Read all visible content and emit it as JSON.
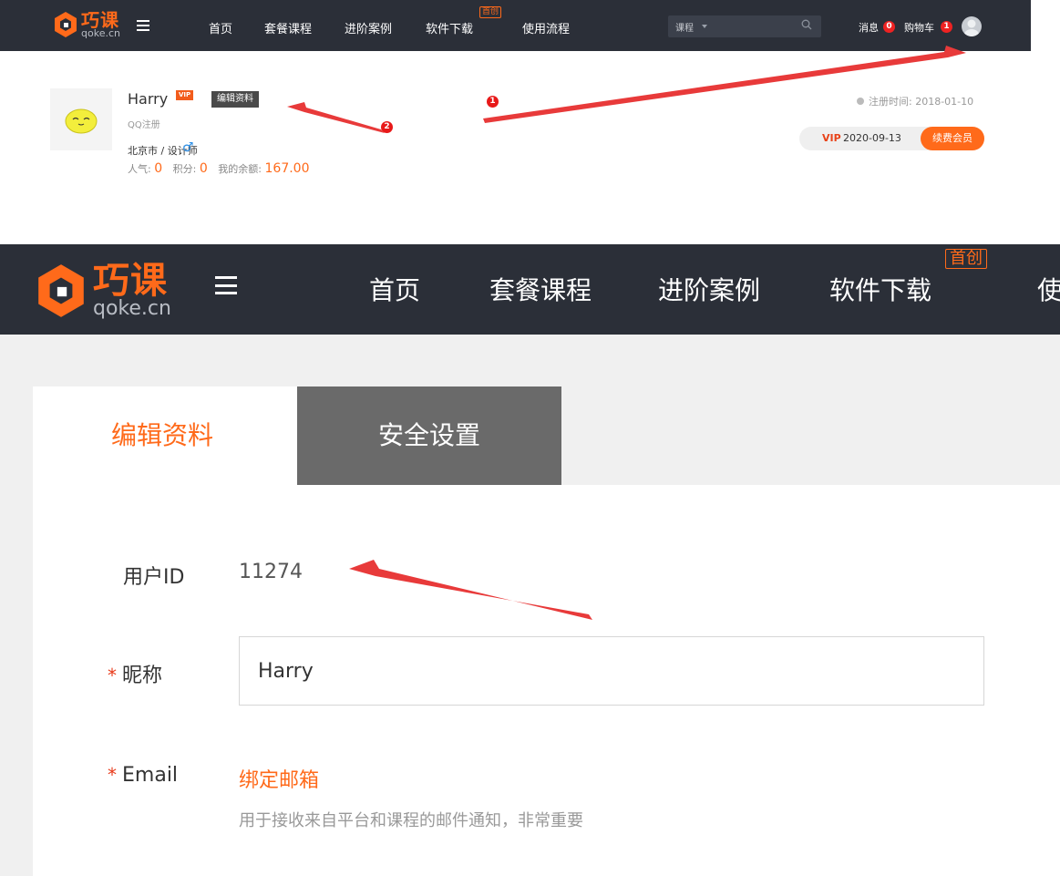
{
  "brand": {
    "name_cn": "巧课",
    "domain": "qoke.cn",
    "accent": "#ff6a1a"
  },
  "nav": {
    "items": [
      "首页",
      "套餐课程",
      "进阶案例",
      "软件下载",
      "使用流程"
    ],
    "new_badge": "首创",
    "search_category": "课程",
    "messages_label": "消息",
    "messages_count": "0",
    "cart_label": "购物车",
    "cart_count": "1"
  },
  "nav_large": {
    "last_item_partial": "使"
  },
  "profile": {
    "name": "Harry",
    "vip_tag": "VIP",
    "edit_button": "编辑资料",
    "reg_source": "QQ注册",
    "location": "北京市 / 设计师",
    "gender_icon": "♂",
    "popularity_label": "人气:",
    "popularity": "0",
    "points_label": "积分:",
    "points": "0",
    "balance_label": "我的余额:",
    "balance": "167.00",
    "reg_time": "注册时间: 2018-01-10",
    "vip_label": "VIP",
    "vip_expiry": "2020-09-13",
    "renew_button": "续费会员"
  },
  "annotations": {
    "marker1": "1",
    "marker2": "2",
    "color": "#e83a3a"
  },
  "settings": {
    "tabs": [
      "编辑资料",
      "安全设置"
    ],
    "user_id_label": "用户ID",
    "user_id": "11274",
    "nickname_label": "昵称",
    "nickname": "Harry",
    "email_label": "Email",
    "bind_email": "绑定邮箱",
    "email_hint": "用于接收来自平台和课程的邮件通知，非常重要",
    "required_mark": "*"
  }
}
